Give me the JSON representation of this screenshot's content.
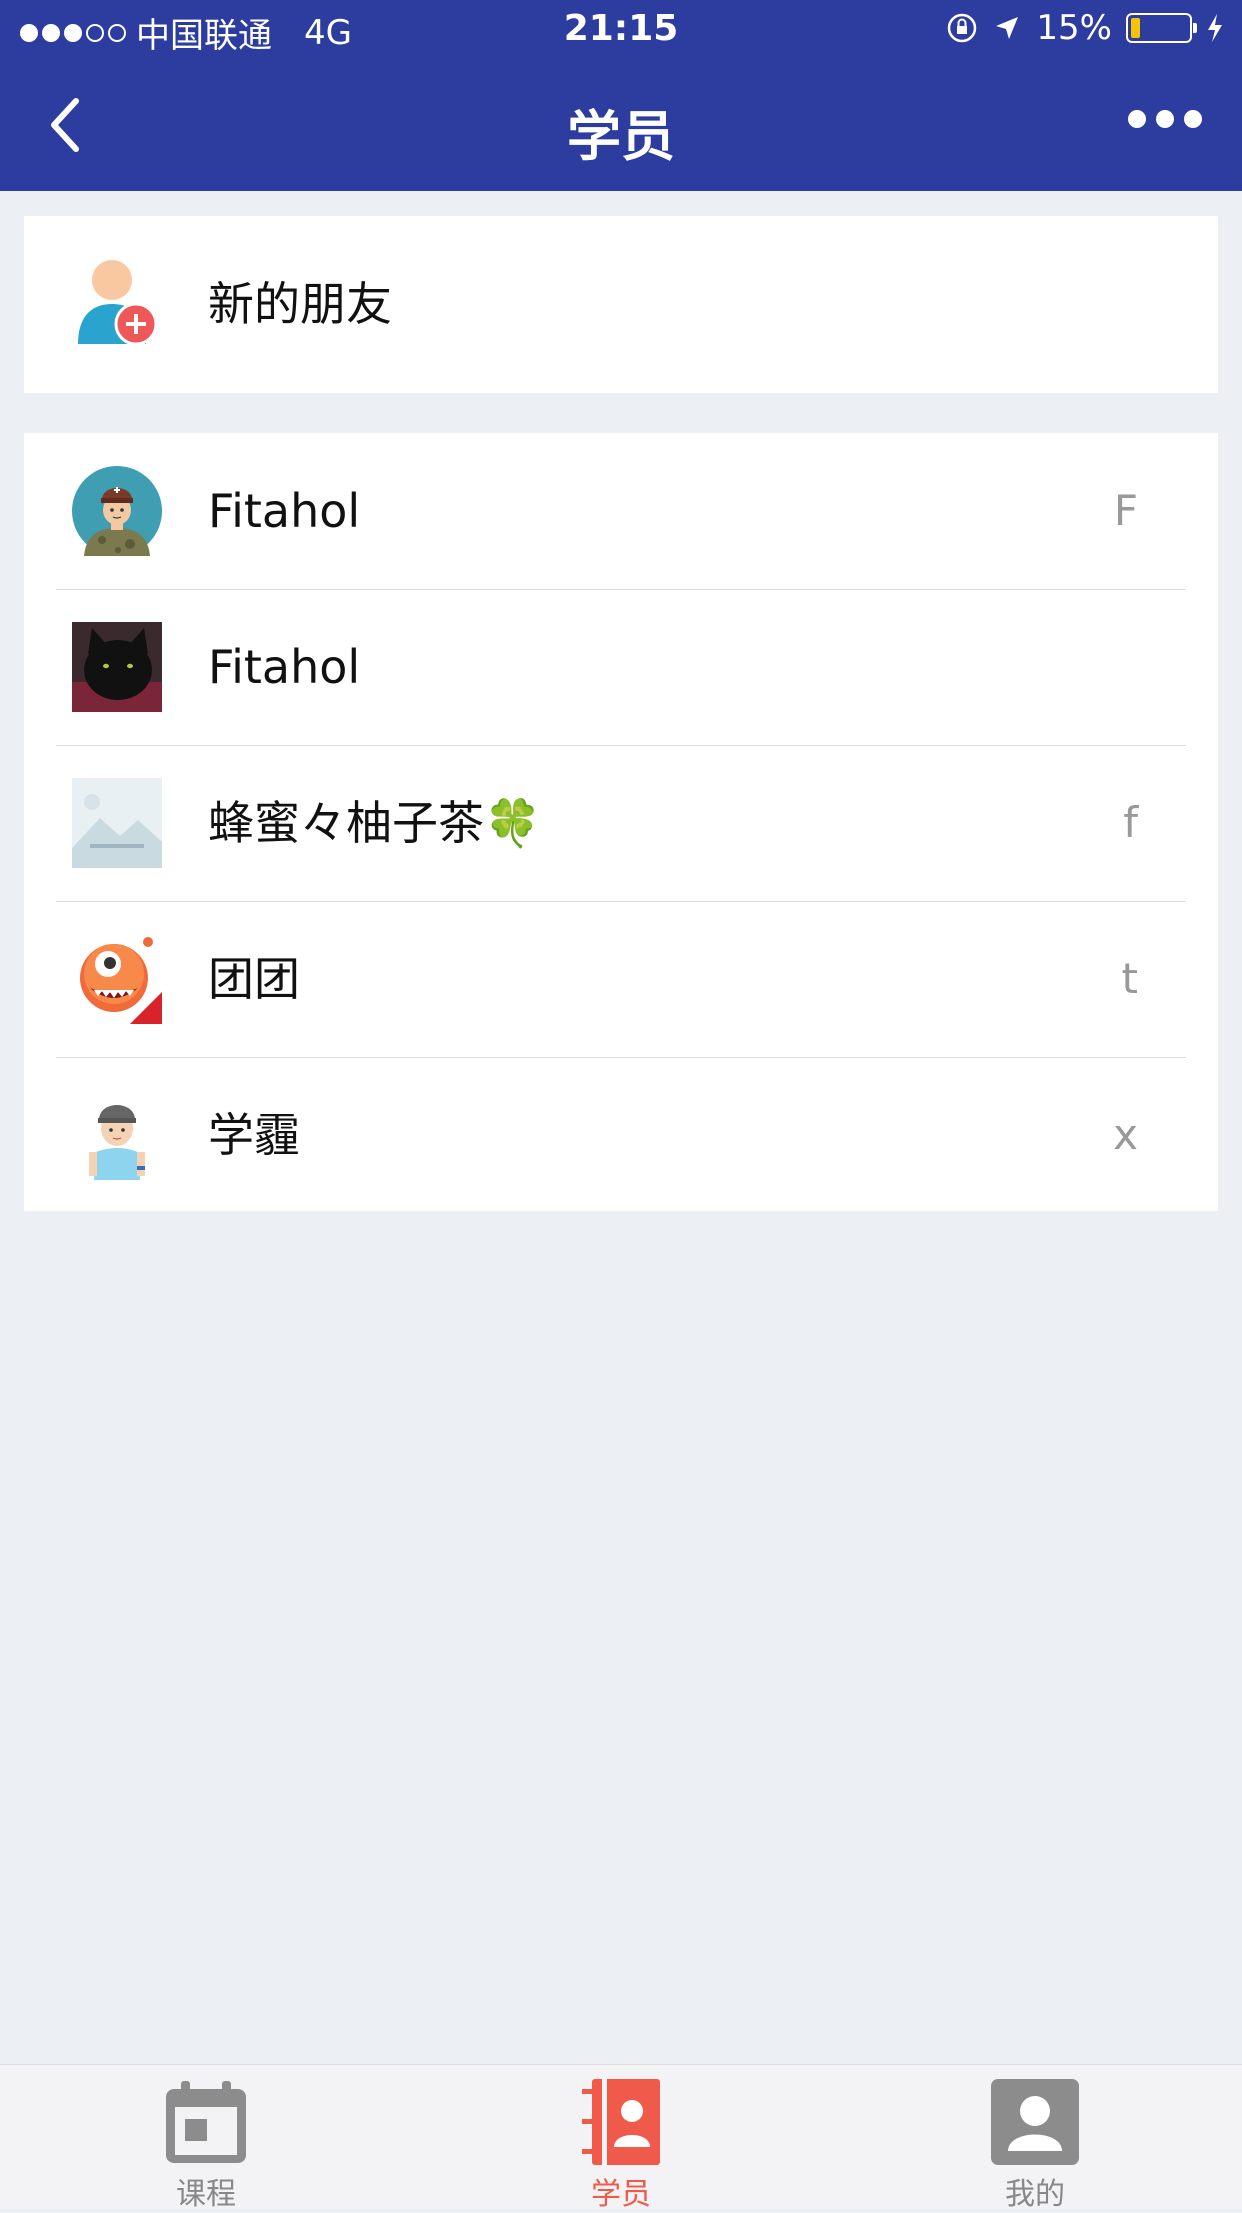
{
  "status_bar": {
    "carrier": "中国联通",
    "network": "4G",
    "time": "21:15",
    "battery": "15%"
  },
  "nav": {
    "title": "学员",
    "back_icon": "chevron-left-icon",
    "more_icon": "more-dots-icon"
  },
  "new_friends": {
    "label": "新的朋友",
    "icon": "add-user-icon"
  },
  "students": [
    {
      "name": "Fitahol",
      "index_letter": "F",
      "avatar": "soldier-avatar"
    },
    {
      "name": "Fitahol",
      "index_letter": "",
      "avatar": "black-cat-avatar"
    },
    {
      "name": "蜂蜜々柚子茶🍀",
      "index_letter": "f",
      "avatar": "placeholder-image-avatar"
    },
    {
      "name": "团团",
      "index_letter": "t",
      "avatar": "cartoon-monster-avatar"
    },
    {
      "name": "学霾",
      "index_letter": "x",
      "avatar": "boy-cap-avatar"
    }
  ],
  "tabs": [
    {
      "label": "课程",
      "icon": "calendar-icon",
      "active": false
    },
    {
      "label": "学员",
      "icon": "contacts-book-icon",
      "active": true
    },
    {
      "label": "我的",
      "icon": "profile-icon",
      "active": false
    }
  ],
  "colors": {
    "primary": "#2D3C9F",
    "accent": "#F05A4A",
    "background": "#ECEFF4"
  }
}
